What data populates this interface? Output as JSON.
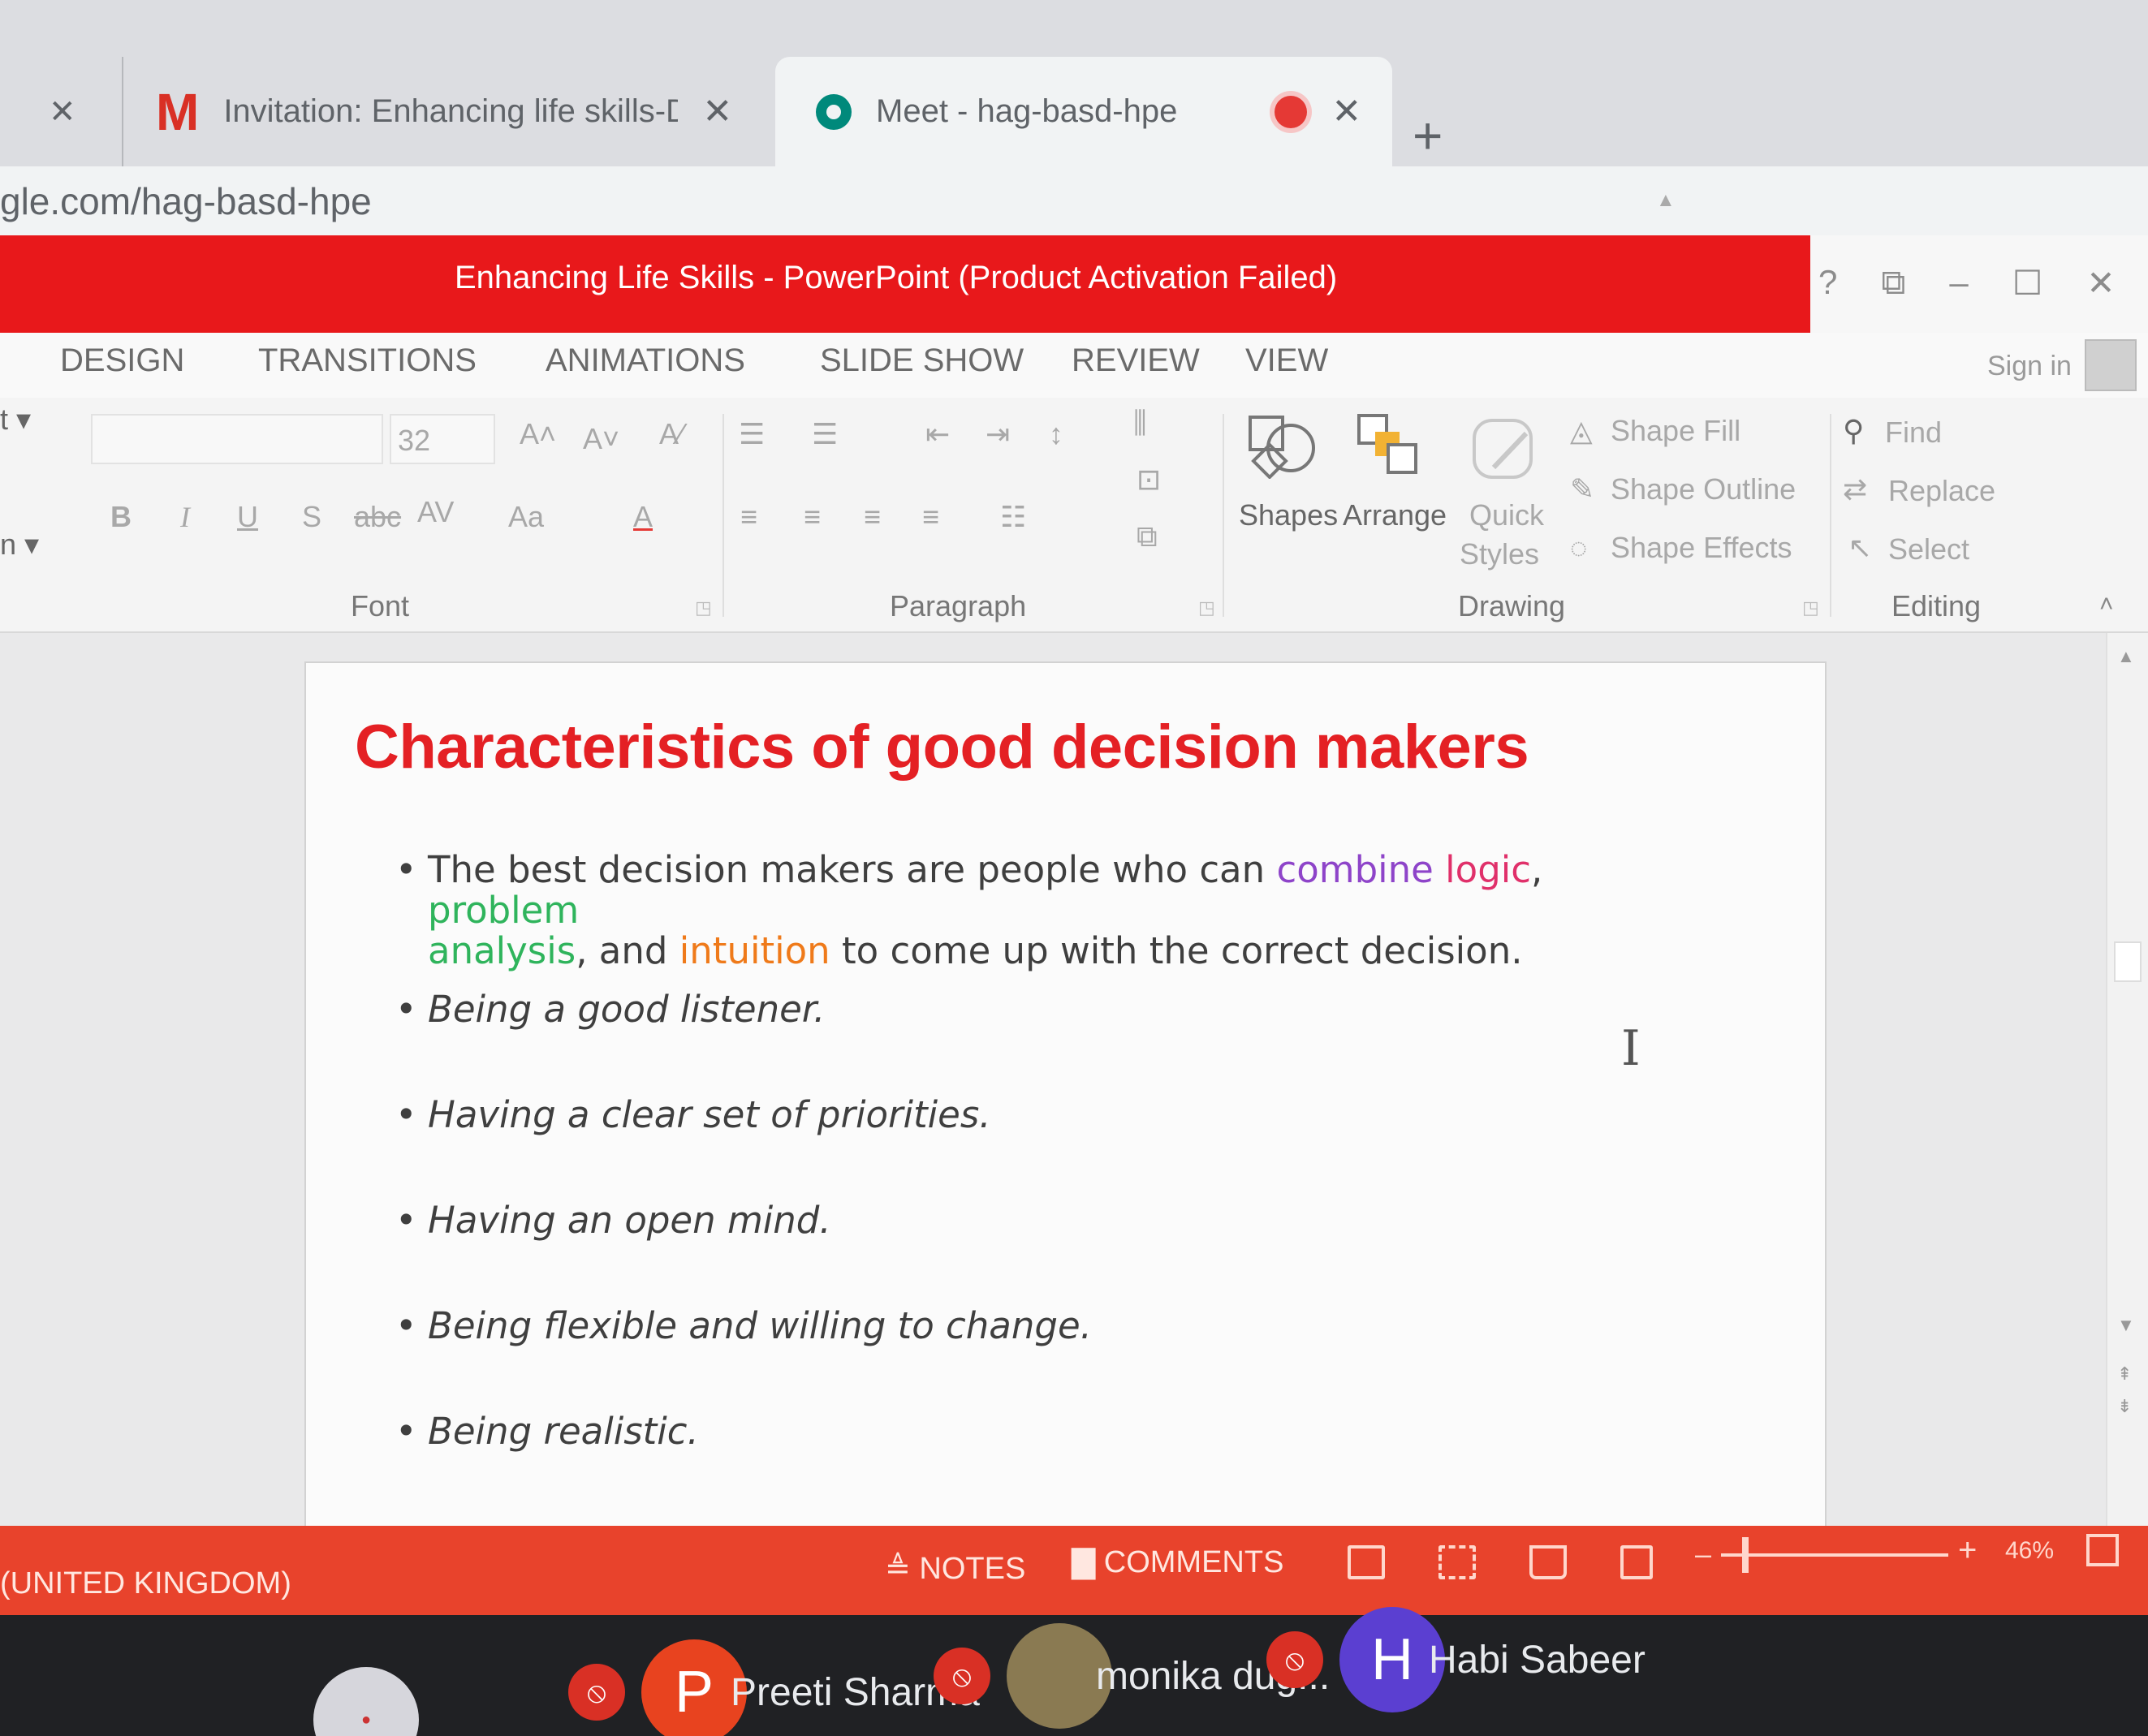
{
  "browser": {
    "left_tab_close": "✕",
    "tabs": [
      {
        "title": "Invitation: Enhancing life skills-D",
        "icon": "gmail-icon",
        "close": "✕"
      },
      {
        "title": "Meet - hag-basd-hpe",
        "icon": "meet-icon",
        "close": "✕"
      }
    ],
    "new_tab": "+",
    "url": "gle.com/hag-basd-hpe"
  },
  "window": {
    "title": "Enhancing Life Skills -  PowerPoint (Product Activation Failed)",
    "buttons": {
      "help": "?",
      "restore_ribbon": "⧉",
      "minimize": "–",
      "maximize": "☐",
      "close": "✕"
    },
    "accent_color": "#e8181b"
  },
  "ribbon_tabs": [
    "DESIGN",
    "TRANSITIONS",
    "ANIMATIONS",
    "SLIDE SHOW",
    "REVIEW",
    "VIEW"
  ],
  "sign_in": "Sign in",
  "ribbon": {
    "left_clip_top": "t ▾",
    "left_clip_bottom": "n ▾",
    "font": {
      "size": "32",
      "grow": "A˄",
      "shrink": "A˅",
      "clear": "A⁄",
      "bold": "B",
      "italic": "I",
      "underline": "U",
      "shadow": "S",
      "strike": "abc",
      "spacing": "AV",
      "case": "Aa",
      "color": "A",
      "label": "Font"
    },
    "paragraph": {
      "label": "Paragraph"
    },
    "drawing": {
      "shapes": "Shapes",
      "arrange": "Arrange",
      "quick": "Quick",
      "styles": "Styles",
      "shape_fill": "Shape Fill",
      "shape_outline": "Shape Outline",
      "shape_effects": "Shape Effects",
      "label": "Drawing"
    },
    "editing": {
      "find": "Find",
      "replace": "Replace",
      "select": "Select",
      "label": "Editing"
    }
  },
  "slide": {
    "title": "Characteristics of good decision makers",
    "first_bullet": {
      "pre": "The best decision makers are people who can ",
      "combine": "combine",
      "sp1": " ",
      "logic": "logic",
      "comma1": ", ",
      "problem": "problem",
      "analysis": "analysis",
      "mid": ", and ",
      "intuition": "intuition",
      "post": " to come up with the correct decision."
    },
    "bullets": [
      "Being a good listener.",
      "Having a clear set of priorities.",
      "Having an open mind.",
      "Being flexible and willing to change.",
      "Being realistic."
    ],
    "title_color": "#e42024"
  },
  "statusbar": {
    "language": "(UNITED KINGDOM)",
    "notes": "NOTES",
    "comments": "COMMENTS",
    "zoom": "46%",
    "zoom_fraction": 0.46,
    "color": "#e8432c"
  },
  "meet": {
    "participants": [
      {
        "initial": "P",
        "name": "Preeti Sharma",
        "muted": true,
        "color": "#e8431f"
      },
      {
        "initial": "",
        "name": "monika dug...",
        "muted": true,
        "color": "#8a7a52"
      },
      {
        "initial": "H",
        "name": "Habi Sabeer",
        "muted": true,
        "color": "#5b3fd1"
      }
    ]
  }
}
